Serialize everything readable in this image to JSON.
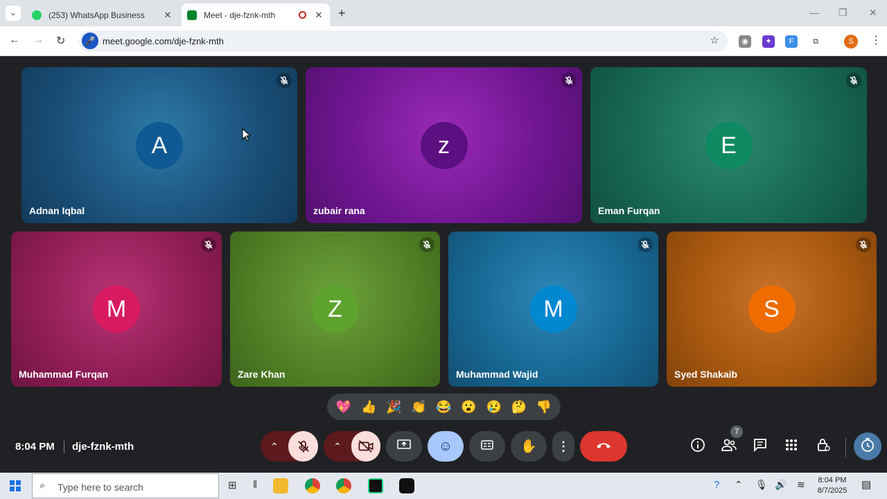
{
  "browser": {
    "tabs": [
      {
        "title": "(253) WhatsApp Business",
        "active": false,
        "fav_color": "#25d366"
      },
      {
        "title": "Meet - dje-fznk-mth",
        "active": true,
        "fav_color": "#00832d"
      }
    ],
    "url": "meet.google.com/dje-fznk-mth",
    "profile_initial": "S"
  },
  "participants": [
    {
      "name": "Adnan Iqbal",
      "initial": "A",
      "color": "#1a4f78",
      "avatar_color": "#0f5a95"
    },
    {
      "name": "zubair rana",
      "initial": "z",
      "color": "#6e1590",
      "avatar_color": "#5b0f80"
    },
    {
      "name": "Eman Furqan",
      "initial": "E",
      "color": "#176852",
      "avatar_color": "#0e8a62"
    },
    {
      "name": "Muhammad Furqan",
      "initial": "M",
      "color": "#8f1d55",
      "avatar_color": "#d81b60"
    },
    {
      "name": "Zare Khan",
      "initial": "Z",
      "color": "#4f7f25",
      "avatar_color": "#5fa32f"
    },
    {
      "name": "Muhammad Wajid",
      "initial": "M",
      "color": "#176792",
      "avatar_color": "#0288d1"
    },
    {
      "name": "Syed Shakaib",
      "initial": "S",
      "color": "#a5570f",
      "avatar_color": "#ef6c00"
    }
  ],
  "reactions": [
    "💖",
    "👍",
    "🎉",
    "👏",
    "😂",
    "😮",
    "😢",
    "🤔",
    "👎"
  ],
  "meeting": {
    "time": "8:04 PM",
    "code": "dje-fznk-mth",
    "participant_count": "7"
  },
  "taskbar": {
    "search_placeholder": "Type here to search",
    "time": "8:04 PM",
    "date": "8/7/2025"
  }
}
